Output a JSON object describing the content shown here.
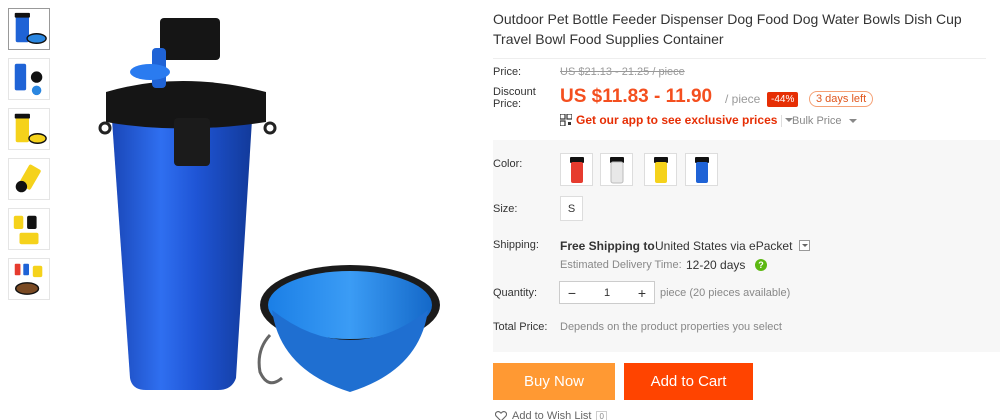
{
  "product": {
    "title": "Outdoor Pet Bottle Feeder Dispenser Dog Food Dog Water Bowls Dish Cup Travel Bowl Food Supplies Container"
  },
  "thumbnails": [
    {
      "icon": "bottle-bowl-thumb"
    },
    {
      "icon": "bottle-parts-thumb"
    },
    {
      "icon": "yellow-bottle-thumb"
    },
    {
      "icon": "yellow-bottle-parts-thumb"
    },
    {
      "icon": "yellow-bottle-set-thumb"
    },
    {
      "icon": "food-bowl-thumb"
    }
  ],
  "price": {
    "label": "Price:",
    "original": "US $21.13 - 21.25 / piece",
    "discount_label": "Discount Price:",
    "current": "US $11.83 - 11.90",
    "unit": "/ piece",
    "discount": "-44%",
    "time_left": "3 days left",
    "app_promo": "Get our app to see exclusive prices",
    "bulk": "Bulk Price"
  },
  "options": {
    "color_label": "Color:",
    "colors": [
      "#e63b2e",
      "#e8e8e8",
      "#f5d21b",
      "#1f63d6"
    ],
    "size_label": "Size:",
    "size": "S"
  },
  "shipping": {
    "label": "Shipping:",
    "free": "Free Shipping to",
    "destination": "United States via ePacket",
    "est_label": "Estimated Delivery Time:",
    "est_value": "12-20 days",
    "help": "?"
  },
  "quantity": {
    "label": "Quantity:",
    "minus": "−",
    "value": "1",
    "plus": "+",
    "available": "piece (20 pieces available)"
  },
  "total": {
    "label": "Total Price:",
    "text": "Depends on the product properties you select"
  },
  "actions": {
    "buy": "Buy Now",
    "cart": "Add to Cart",
    "wish": "Add to Wish List",
    "wish_count": "0"
  }
}
